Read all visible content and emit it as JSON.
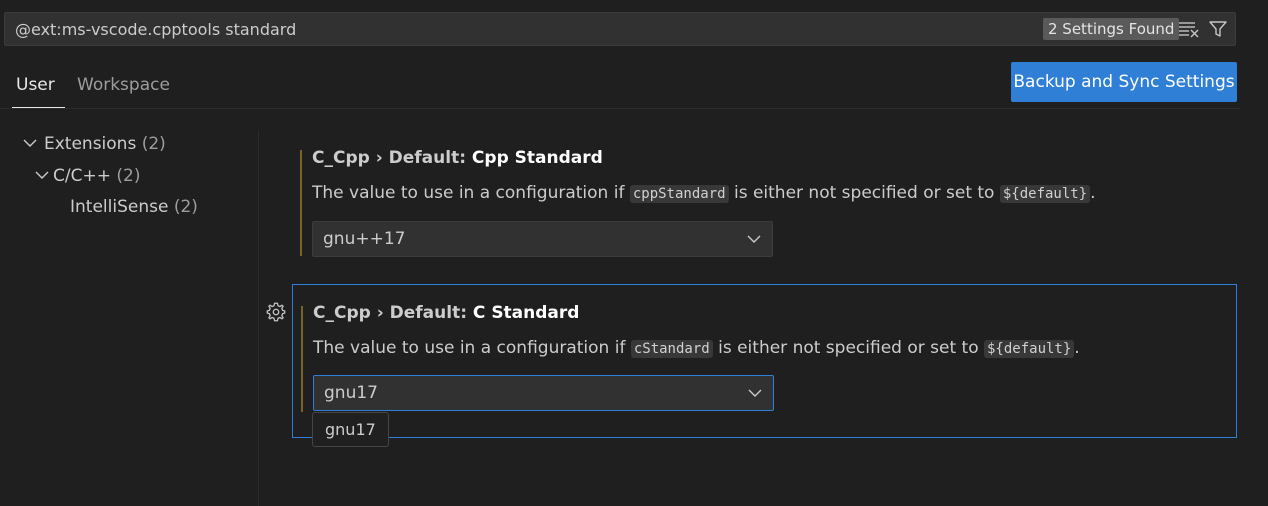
{
  "search": {
    "query": "@ext:ms-vscode.cpptools standard",
    "found_label": "2 Settings Found",
    "icons": [
      "clear-filter-icon",
      "filter-icon"
    ]
  },
  "tabs": [
    {
      "label": "User",
      "active": true
    },
    {
      "label": "Workspace",
      "active": false
    }
  ],
  "sync_button": {
    "label": "Backup and Sync Settings"
  },
  "toc": [
    {
      "label": "Extensions",
      "count": "(2)",
      "expanded": true
    },
    {
      "label": "C/C++",
      "count": "(2)",
      "expanded": true
    },
    {
      "label": "IntelliSense",
      "count": "(2)"
    }
  ],
  "settings": [
    {
      "category": "C_Cpp › Default: ",
      "name": "Cpp Standard",
      "desc_before": "The value to use in a configuration if ",
      "desc_code1": "cppStandard",
      "desc_middle": " is either not specified or set to ",
      "desc_code2": "${default}",
      "desc_after": ".",
      "value": "gnu++17"
    },
    {
      "category": "C_Cpp › Default: ",
      "name": "C Standard",
      "desc_before": "The value to use in a configuration if ",
      "desc_code1": "cStandard",
      "desc_middle": " is either not specified or set to ",
      "desc_code2": "${default}",
      "desc_after": ".",
      "value": "gnu17",
      "tooltip": "gnu17"
    }
  ],
  "colors": {
    "accent": "#2f7fd6",
    "modified": "#7a6228",
    "background": "#1f1f1f"
  }
}
